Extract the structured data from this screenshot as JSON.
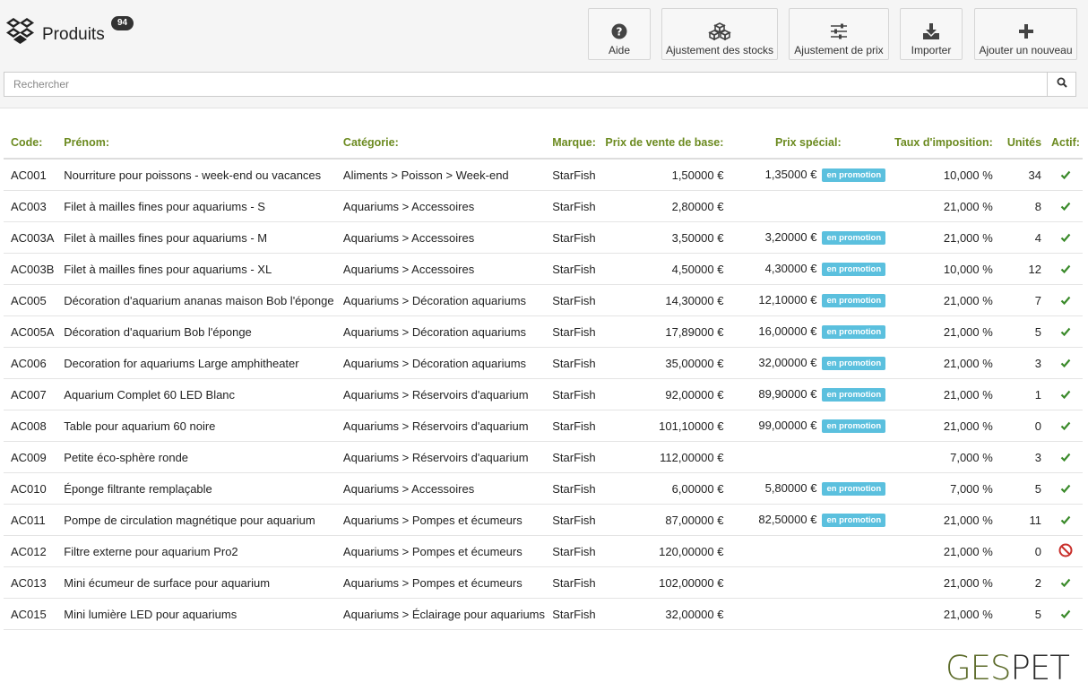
{
  "header": {
    "title": "Produits",
    "count": "94"
  },
  "toolbar": [
    {
      "label": "Aide",
      "icon": "help-icon"
    },
    {
      "label": "Ajustement des stocks",
      "icon": "cubes-icon"
    },
    {
      "label": "Ajustement de prix",
      "icon": "sliders-icon"
    },
    {
      "label": "Importer",
      "icon": "download-icon"
    },
    {
      "label": "Ajouter un nouveau",
      "icon": "plus-icon"
    }
  ],
  "search": {
    "placeholder": "Rechercher",
    "value": ""
  },
  "table": {
    "columns": [
      "Code:",
      "Prénom:",
      "Catégorie:",
      "Marque:",
      "Prix de vente de base:",
      "Prix spécial:",
      "Taux d'imposition:",
      "Unités",
      "Actif:"
    ],
    "promo_label": "en promotion",
    "rows": [
      {
        "code": "AC001",
        "name": "Nourriture pour poissons - week-end ou vacances",
        "category": "Aliments > Poisson > Week-end",
        "brand": "StarFish",
        "base_price": "1,50000 €",
        "special_price": "1,35000 €",
        "promo": true,
        "tax": "10,000 %",
        "units": "34",
        "active": true
      },
      {
        "code": "AC003",
        "name": "Filet à mailles fines pour aquariums - S",
        "category": "Aquariums > Accessoires",
        "brand": "StarFish",
        "base_price": "2,80000 €",
        "special_price": "",
        "promo": false,
        "tax": "21,000 %",
        "units": "8",
        "active": true
      },
      {
        "code": "AC003A",
        "name": "Filet à mailles fines pour aquariums - M",
        "category": "Aquariums > Accessoires",
        "brand": "StarFish",
        "base_price": "3,50000 €",
        "special_price": "3,20000 €",
        "promo": true,
        "tax": "21,000 %",
        "units": "4",
        "active": true
      },
      {
        "code": "AC003B",
        "name": "Filet à mailles fines pour aquariums - XL",
        "category": "Aquariums > Accessoires",
        "brand": "StarFish",
        "base_price": "4,50000 €",
        "special_price": "4,30000 €",
        "promo": true,
        "tax": "10,000 %",
        "units": "12",
        "active": true
      },
      {
        "code": "AC005",
        "name": "Décoration d'aquarium  ananas maison Bob l'éponge",
        "category": "Aquariums > Décoration aquariums",
        "brand": "StarFish",
        "base_price": "14,30000 €",
        "special_price": "12,10000 €",
        "promo": true,
        "tax": "21,000 %",
        "units": "7",
        "active": true
      },
      {
        "code": "AC005A",
        "name": "Décoration d'aquarium Bob l'éponge",
        "category": "Aquariums > Décoration aquariums",
        "brand": "StarFish",
        "base_price": "17,89000 €",
        "special_price": "16,00000 €",
        "promo": true,
        "tax": "21,000 %",
        "units": "5",
        "active": true
      },
      {
        "code": "AC006",
        "name": "Decoration for aquariums Large amphitheater",
        "category": "Aquariums > Décoration aquariums",
        "brand": "StarFish",
        "base_price": "35,00000 €",
        "special_price": "32,00000 €",
        "promo": true,
        "tax": "21,000 %",
        "units": "3",
        "active": true
      },
      {
        "code": "AC007",
        "name": "Aquarium Complet 60 LED Blanc",
        "category": "Aquariums > Réservoirs d'aquarium",
        "brand": "StarFish",
        "base_price": "92,00000 €",
        "special_price": "89,90000 €",
        "promo": true,
        "tax": "21,000 %",
        "units": "1",
        "active": true
      },
      {
        "code": "AC008",
        "name": "Table pour aquarium 60 noire",
        "category": "Aquariums > Réservoirs d'aquarium",
        "brand": "StarFish",
        "base_price": "101,10000 €",
        "special_price": "99,00000 €",
        "promo": true,
        "tax": "21,000 %",
        "units": "0",
        "active": true
      },
      {
        "code": "AC009",
        "name": "Petite éco-sphère ronde",
        "category": "Aquariums > Réservoirs d'aquarium",
        "brand": "StarFish",
        "base_price": "112,00000 €",
        "special_price": "",
        "promo": false,
        "tax": "7,000 %",
        "units": "3",
        "active": true
      },
      {
        "code": "AC010",
        "name": "Éponge filtrante remplaçable",
        "category": "Aquariums > Accessoires",
        "brand": "StarFish",
        "base_price": "6,00000 €",
        "special_price": "5,80000 €",
        "promo": true,
        "tax": "7,000 %",
        "units": "5",
        "active": true
      },
      {
        "code": "AC011",
        "name": "Pompe de circulation magnétique pour aquarium",
        "category": "Aquariums > Pompes et écumeurs",
        "brand": "StarFish",
        "base_price": "87,00000 €",
        "special_price": "82,50000 €",
        "promo": true,
        "tax": "21,000 %",
        "units": "11",
        "active": true
      },
      {
        "code": "AC012",
        "name": "Filtre externe pour aquarium Pro2",
        "category": "Aquariums > Pompes et écumeurs",
        "brand": "StarFish",
        "base_price": "120,00000 €",
        "special_price": "",
        "promo": false,
        "tax": "21,000 %",
        "units": "0",
        "active": false
      },
      {
        "code": "AC013",
        "name": "Mini écumeur de surface pour aquarium",
        "category": "Aquariums > Pompes et écumeurs",
        "brand": "StarFish",
        "base_price": "102,00000 €",
        "special_price": "",
        "promo": false,
        "tax": "21,000 %",
        "units": "2",
        "active": true
      },
      {
        "code": "AC015",
        "name": "Mini lumière LED pour aquariums",
        "category": "Aquariums > Éclairage pour aquariums",
        "brand": "StarFish",
        "base_price": "32,00000 €",
        "special_price": "",
        "promo": false,
        "tax": "21,000 %",
        "units": "5",
        "active": true
      }
    ]
  },
  "logo": {
    "text_a": "GES",
    "text_b": "PET"
  },
  "colors": {
    "header_green": "#6b8a1f",
    "promo_blue": "#5bc0de",
    "active_green": "#3a8a2a",
    "inactive_red": "#c9302c"
  }
}
